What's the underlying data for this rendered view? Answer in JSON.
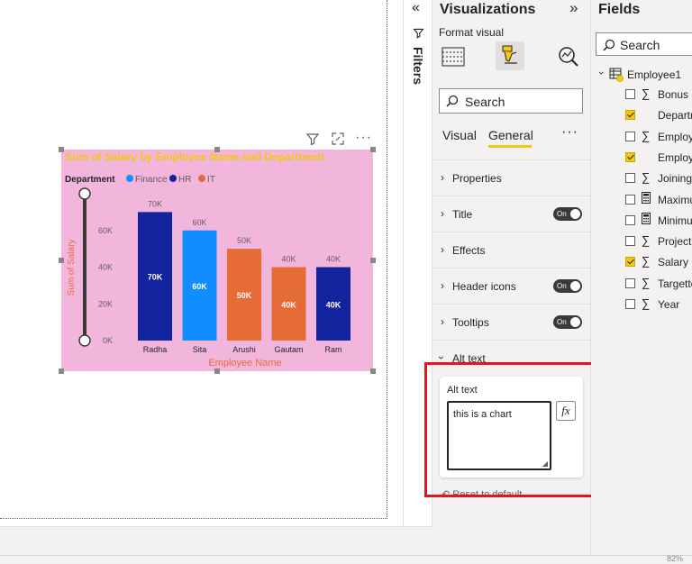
{
  "filters": {
    "label": "Filters"
  },
  "visualizations": {
    "title": "Visualizations",
    "format_visual_label": "Format visual",
    "search_placeholder": "Search",
    "tabs": [
      "Visual",
      "General"
    ],
    "active_tab": "General",
    "more": "···",
    "sections": [
      {
        "label": "Properties",
        "toggle": null
      },
      {
        "label": "Title",
        "toggle": "On"
      },
      {
        "label": "Effects",
        "toggle": null
      },
      {
        "label": "Header icons",
        "toggle": "On"
      },
      {
        "label": "Tooltips",
        "toggle": "On"
      }
    ],
    "alt_text_section": "Alt text",
    "alt_text_card_label": "Alt text",
    "alt_text_value": "this is a chart",
    "fx_label": "fx",
    "reset_label": "Reset to default"
  },
  "fields": {
    "title": "Fields",
    "search_placeholder": "Search",
    "table_name": "Employee1",
    "items": [
      {
        "name": "Bonus",
        "icon": "sigma",
        "checked": false
      },
      {
        "name": "Departr",
        "icon": "none",
        "checked": true
      },
      {
        "name": "Employ",
        "icon": "sigma",
        "checked": false
      },
      {
        "name": "Employ",
        "icon": "none",
        "checked": true
      },
      {
        "name": "Joining",
        "icon": "sigma",
        "checked": false
      },
      {
        "name": "Maximu",
        "icon": "calculator",
        "checked": false
      },
      {
        "name": "Minimu",
        "icon": "calculator",
        "checked": false
      },
      {
        "name": "Projects",
        "icon": "sigma",
        "checked": false
      },
      {
        "name": "Salary",
        "icon": "sigma",
        "checked": true
      },
      {
        "name": "Targette",
        "icon": "sigma",
        "checked": false
      },
      {
        "name": "Year",
        "icon": "sigma",
        "checked": false
      }
    ]
  },
  "status": {
    "zoom_text": "82%"
  },
  "colors": {
    "finance": "#118dff",
    "hr": "#12239e",
    "it": "#e66c37",
    "title": "#f2c811",
    "axis_label": "#e66c37",
    "bg": "#f2b6dd",
    "highlight": "#e3151f"
  },
  "chart_data": {
    "type": "bar",
    "title": "Sum of Salary by Employee Name and Department",
    "legend_title": "Department",
    "legend": [
      "Finance",
      "HR",
      "IT"
    ],
    "xlabel": "Employee Name",
    "ylabel": "Sum of Salary",
    "ylim": [
      0,
      80000
    ],
    "yticks": [
      "0K",
      "20K",
      "40K",
      "60K"
    ],
    "ytick_values": [
      0,
      20000,
      40000,
      60000
    ],
    "categories": [
      "Radha",
      "Sita",
      "Arushi",
      "Gautam",
      "Ram"
    ],
    "values": [
      70000,
      60000,
      50000,
      40000,
      40000
    ],
    "departments": [
      "HR",
      "Finance",
      "IT",
      "IT",
      "HR"
    ],
    "labels": [
      "70K",
      "60K",
      "50K",
      "40K",
      "40K"
    ],
    "grid": false,
    "legend_position": "top-left"
  }
}
